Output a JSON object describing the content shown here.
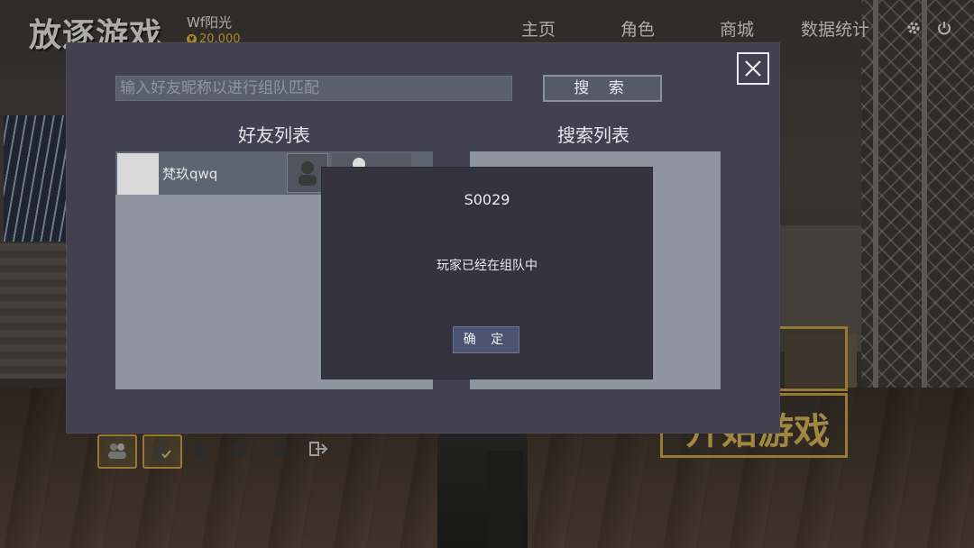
{
  "header": {
    "logo": "放逐游戏",
    "player_name": "Wf阳光",
    "coins": "20,000",
    "nav": [
      "主页",
      "角色",
      "商城",
      "数据统计"
    ],
    "settings_icon": "gear-icon",
    "power_icon": "power-icon"
  },
  "background": {
    "start_button_label": "开始游戏"
  },
  "team_panel": {
    "title_friends": "好友列表",
    "title_search": "搜索列表",
    "search_placeholder": "输入好友昵称以进行组队匹配",
    "search_button": "搜 索",
    "friends": [
      {
        "name": "梵玖qwq"
      }
    ]
  },
  "dialog": {
    "code": "S0029",
    "message": "玩家已经在组队中",
    "confirm_label": "确 定"
  },
  "colors": {
    "accent_gold": "#c9a246",
    "modal_bg": "#434150",
    "dialog_bg": "#35343e"
  }
}
